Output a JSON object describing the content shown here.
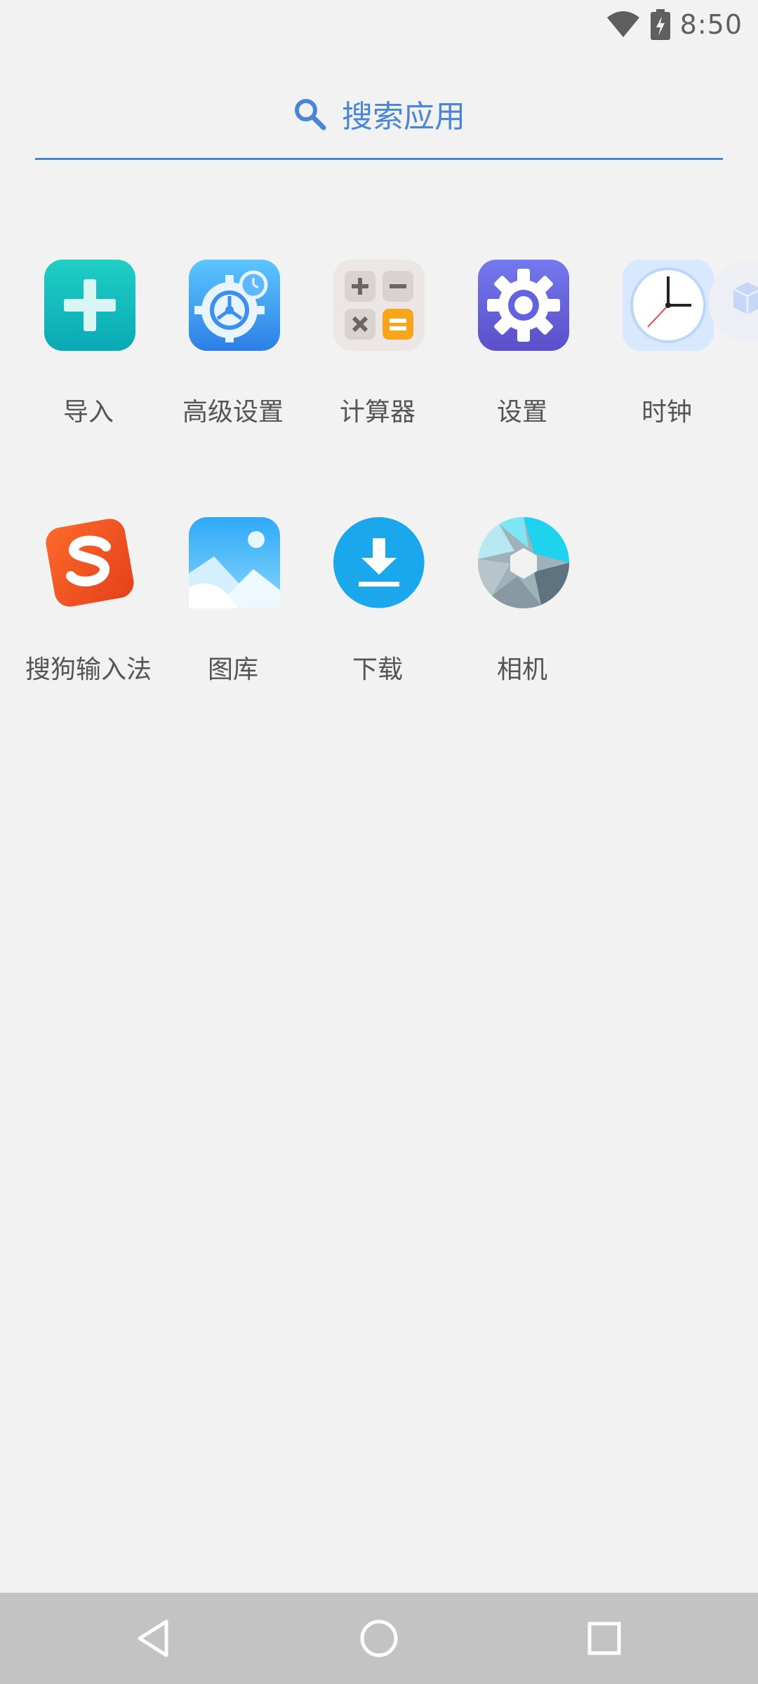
{
  "status_bar": {
    "time": "8:50",
    "wifi_icon": "wifi-icon",
    "battery_icon": "battery-charging-icon"
  },
  "search": {
    "placeholder": "搜索应用",
    "icon": "search-icon",
    "accent_color": "#4a86d6"
  },
  "apps": [
    {
      "label": "导入",
      "icon": "import-plus-icon"
    },
    {
      "label": "高级设置",
      "icon": "advanced-settings-icon"
    },
    {
      "label": "计算器",
      "icon": "calculator-icon"
    },
    {
      "label": "设置",
      "icon": "settings-gear-icon"
    },
    {
      "label": "时钟",
      "icon": "clock-icon"
    },
    {
      "label": "搜狗输入法",
      "icon": "sogou-input-icon"
    },
    {
      "label": "图库",
      "icon": "gallery-icon"
    },
    {
      "label": "下载",
      "icon": "download-icon"
    },
    {
      "label": "相机",
      "icon": "camera-aperture-icon"
    }
  ],
  "nav_bar": {
    "back": "back-triangle-icon",
    "home": "home-circle-icon",
    "recents": "recents-square-icon"
  }
}
